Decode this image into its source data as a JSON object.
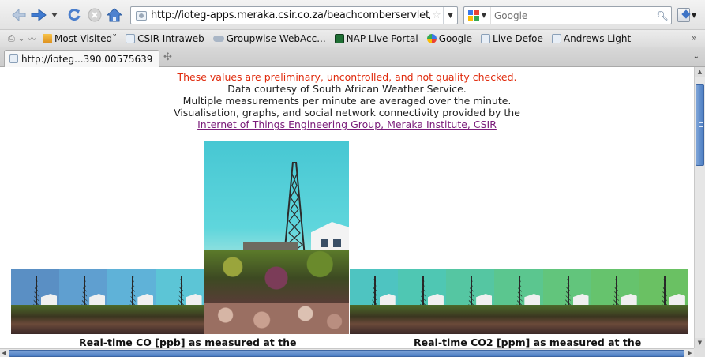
{
  "browser": {
    "url": "http://ioteg-apps.meraka.csir.co.za/beachcomberservlet/pl",
    "search_placeholder": "Google",
    "tab_title": "http://ioteg...390.00575639"
  },
  "bookmarks": [
    {
      "label": "Most Visited",
      "icon": "folder-icon",
      "dropdown": "˅"
    },
    {
      "label": "CSIR Intraweb",
      "icon": "page-icon"
    },
    {
      "label": "Groupwise WebAcc...",
      "icon": "groupwise-icon"
    },
    {
      "label": "NAP Live Portal",
      "icon": "nap-icon"
    },
    {
      "label": "Google",
      "icon": "google-icon"
    },
    {
      "label": "Live Defoe",
      "icon": "page-icon"
    },
    {
      "label": "Andrews Light",
      "icon": "page-icon"
    }
  ],
  "bookmarks_more": "»",
  "page": {
    "warning": "These values are preliminary, uncontrolled, and not quality checked.",
    "courtesy": "Data courtesy of South African Weather Service.",
    "averaging": "Multiple measurements per minute are averaged over the minute.",
    "visualisation": "Visualisation, graphs, and social network connectivity provided by the",
    "link": "Internet of Things Engineering Group, Meraka Institute, CSIR",
    "caption_co": "Real-time CO [ppb] as measured at the",
    "caption_co2": "Real-time CO2 [ppm] as measured at the"
  },
  "thumbnails": {
    "left_tints": [
      "#5a8fc4",
      "#5f9fd0",
      "#5fb2d8",
      "#5cc5d6"
    ],
    "right_tints": [
      "#4ec4c1",
      "#4fc7b3",
      "#55c6a2",
      "#5bc68f",
      "#62c57c",
      "#66c36d",
      "#6ac163"
    ]
  }
}
